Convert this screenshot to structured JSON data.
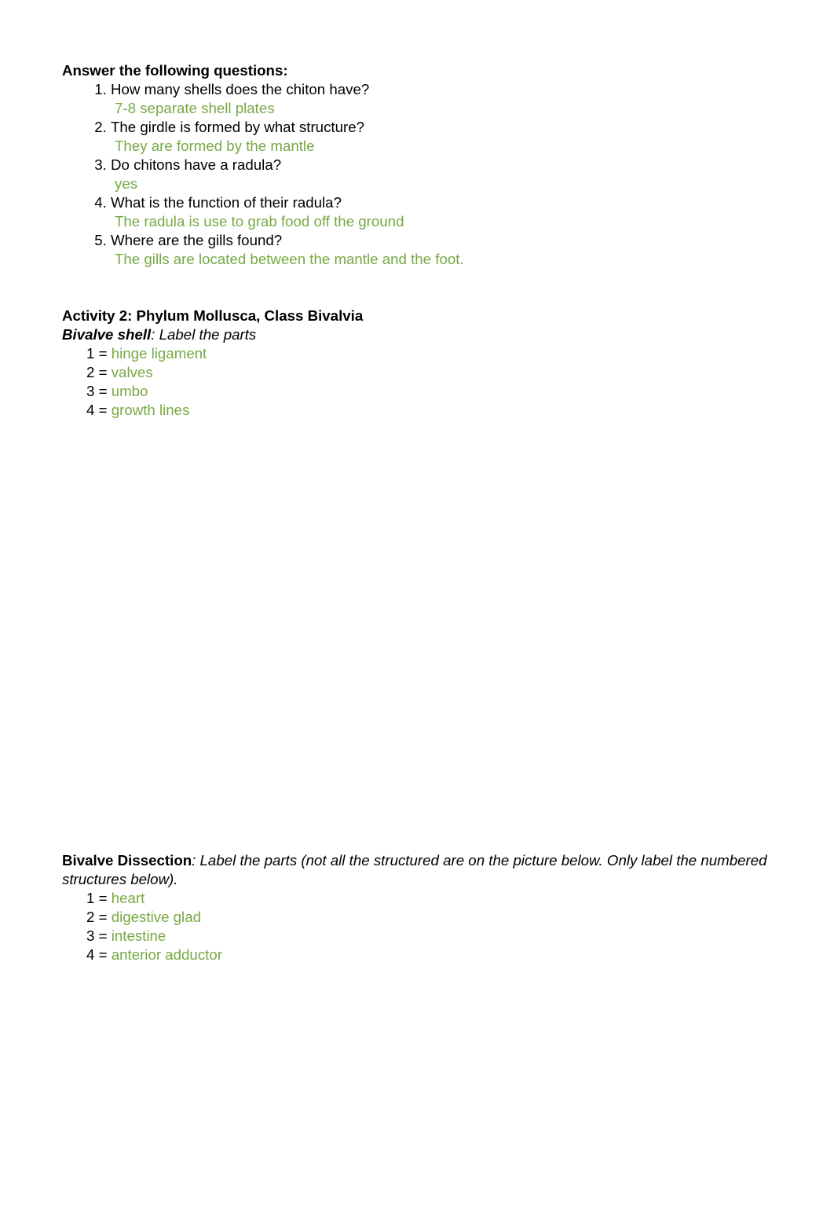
{
  "document": {
    "questions_section": {
      "heading": "Answer the following questions:",
      "items": [
        {
          "question": "How many shells does the chiton have?",
          "answer": "7-8 separate shell plates"
        },
        {
          "question": "The girdle is formed by what structure?",
          "answer": "They are formed by the mantle"
        },
        {
          "question": "Do chitons have a radula?",
          "answer": "yes"
        },
        {
          "question": "What is the function of their radula?",
          "answer": "The radula is use to grab food off the ground"
        },
        {
          "question": "Where are the gills found?",
          "answer": "The gills are located between the mantle and the foot."
        }
      ]
    },
    "activity_2": {
      "heading": "Activity 2: Phylum Mollusca, Class Bivalvia",
      "subheading_bold": "Bivalve shell",
      "subheading_rest": ": Label the parts",
      "labels": [
        {
          "number": "1 =",
          "label": "hinge ligament"
        },
        {
          "number": "2 =",
          "label": "valves"
        },
        {
          "number": "3 =",
          "label": "umbo"
        },
        {
          "number": "4 =",
          "label": "growth lines"
        }
      ]
    },
    "bivalve_dissection": {
      "heading_bold": "Bivalve Dissection",
      "heading_rest": ": Label the parts (not all the structured are on the picture below. Only label the numbered structures below).",
      "labels": [
        {
          "number": "1 =",
          "label": "heart"
        },
        {
          "number": "2 =",
          "label": "digestive glad"
        },
        {
          "number": "3 =",
          "label": "intestine"
        },
        {
          "number": "4 =",
          "label": "anterior adductor"
        }
      ]
    },
    "colors": {
      "answer_green": "#76A943",
      "text_black": "#000000",
      "page_background": "#FFFFFF"
    }
  }
}
